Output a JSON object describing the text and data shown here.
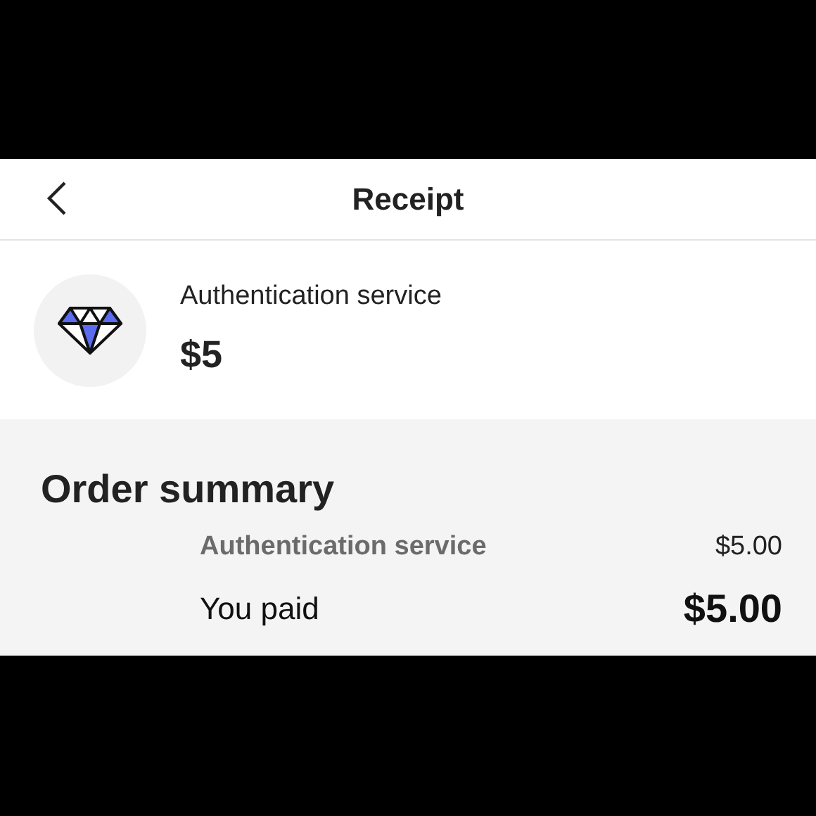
{
  "header": {
    "title": "Receipt"
  },
  "item": {
    "name": "Authentication service",
    "price": "$5"
  },
  "order_summary": {
    "title": "Order summary",
    "rows": [
      {
        "kind": "line",
        "label": "Authentication service",
        "amount": "$5.00"
      },
      {
        "kind": "total",
        "label": "You paid",
        "amount": "$5.00"
      }
    ]
  }
}
